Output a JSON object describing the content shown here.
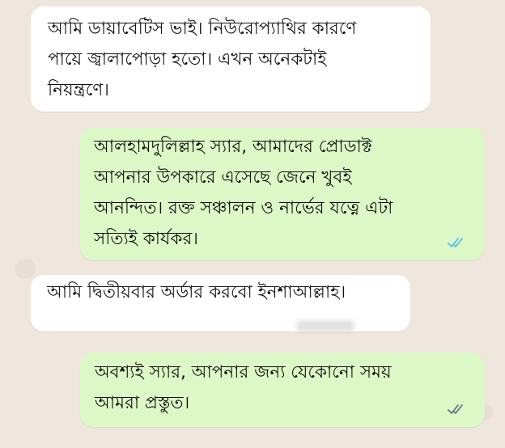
{
  "messages": [
    {
      "direction": "incoming",
      "text": "আমি ডায়াবেটিস ভাই। নিউরোপ্যাথির কারণে\nপায়ে জ্বালাপোড়া হতো। এখন অনেকটাই\nনিয়ন্ত্রণে।"
    },
    {
      "direction": "outgoing",
      "text": "আলহামদুলিল্লাহ স্যার, আমাদের প্রোডাক্ট\nআপনার উপকারে এসেছে জেনে খুবই\nআনন্দিত। রক্ত সঞ্চালন ও নার্ভের যত্নে এটা\nসত্যিই কার্যকর।",
      "status_icon": "double-check-read-icon",
      "status_color": "#53bdeb"
    },
    {
      "direction": "incoming",
      "text": "আমি দ্বিতীয়বার অর্ডার করবো ইনশাআল্লাহ।"
    },
    {
      "direction": "outgoing",
      "text": "অবশ্যই স্যার, আপনার জন্য যেকোনো সময়\nআমরা প্রস্তুত।",
      "status_icon": "double-check-delivered-icon",
      "status_color": "#667781"
    }
  ],
  "colors": {
    "chat_background": "#efe7dd",
    "incoming_bubble": "#ffffff",
    "outgoing_bubble": "#dcf8c6"
  }
}
